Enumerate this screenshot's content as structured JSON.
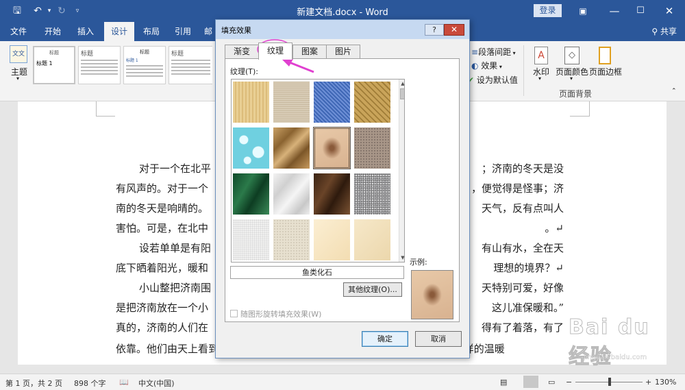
{
  "titlebar": {
    "title": "新建文档.docx - Word",
    "login": "登录"
  },
  "ribbon_tabs": [
    "文件",
    "开始",
    "插入",
    "设计",
    "布局",
    "引用",
    "邮"
  ],
  "ribbon_active_tab": "设计",
  "share_label": "共享",
  "ribbon": {
    "theme_label": "主题",
    "gallery": {
      "heading1": "标题 1",
      "heading": "标题",
      "heading_small": "标题",
      "heading1_small": "标题 1",
      "heading_alt": "标题"
    },
    "paragraph_spacing": "段落间距",
    "effects": "效果",
    "set_default": "设为默认值",
    "watermark": "水印",
    "page_color": "页面颜色",
    "page_border": "页面边框",
    "group_page_background": "页面背景"
  },
  "document": {
    "lines": [
      "对于一个在北平",
      "有风声的。对于一个",
      "南的冬天是响晴的。",
      "害怕。可是，在北中",
      "设若单单是有阳",
      "底下晒着阳光，暖和",
      "小山整把济南围",
      "是把济南放在一个小",
      "真的，济南的人们在",
      "依靠。他们由天上看到山上，便不知不觉地想起:“明天也许就是春天了吧？这样的温暖"
    ],
    "lines_right": [
      "；济南的冬天是没",
      "，便觉得是怪事；济",
      "天气，反有点叫人",
      "。↵",
      "有山有水，全在天",
      "理想的境界？↵",
      "天特别可爱，好像",
      "这儿准保暖和。”",
      "得有了着落，有了",
      ""
    ]
  },
  "dialog": {
    "title": "填充效果",
    "help": "?",
    "close": "✕",
    "tabs": [
      "渐变",
      "纹理",
      "图案",
      "图片"
    ],
    "active_tab": "纹理",
    "texture_label": "纹理(T):",
    "textures": [
      "papyrus",
      "canvas",
      "blue-tissue",
      "woven-mat",
      "water-droplets",
      "brown-paper-bag",
      "fish-fossil",
      "sand",
      "green-marble",
      "white-marble",
      "brown-marble",
      "granite",
      "newsprint",
      "recycled-paper",
      "parchment",
      "stationery"
    ],
    "selected_texture": "fish-fossil",
    "texture_name": "鱼类化石",
    "other_textures": "其他纹理(O)...",
    "rotate_label": "随图形旋转填充效果(W)",
    "sample_label": "示例:",
    "ok": "确定",
    "cancel": "取消"
  },
  "statusbar": {
    "page": "第 1 页，共 2 页",
    "words": "898 个字",
    "language": "中文(中国)",
    "zoom": "130%"
  },
  "colors": {
    "word_blue": "#2b579a",
    "annotation": "#e040d0"
  },
  "watermark_text": "Bai du 经验",
  "watermark_url": "jingyan.baidu.com"
}
